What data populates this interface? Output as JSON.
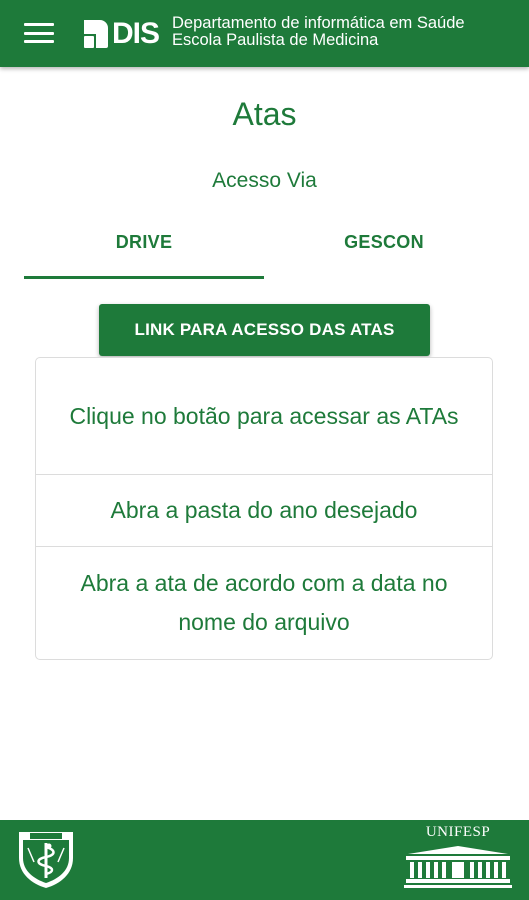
{
  "header": {
    "menu_icon": "hamburger-menu-icon",
    "logo_text": "DIS",
    "line1": "Departamento de informática em Saúde",
    "line2": "Escola Paulista de Medicina"
  },
  "page": {
    "title": "Atas",
    "subtitle": "Acesso Via"
  },
  "tabs": [
    {
      "label": "DRIVE",
      "active": true
    },
    {
      "label": "GESCON",
      "active": false
    }
  ],
  "main": {
    "link_button": "LINK PARA ACESSO DAS ATAS",
    "instructions": [
      "Clique no botão para acessar as ATAs",
      "Abra a pasta do ano desejado",
      "Abra a ata de acordo com a data no nome do arquivo"
    ]
  },
  "footer": {
    "left_logo": "epm-seal-icon",
    "right_logo_text": "UNIFESP"
  },
  "colors": {
    "primary": "#1e7a3a",
    "text_on_primary": "#ffffff",
    "divider": "#dcdcdc"
  }
}
